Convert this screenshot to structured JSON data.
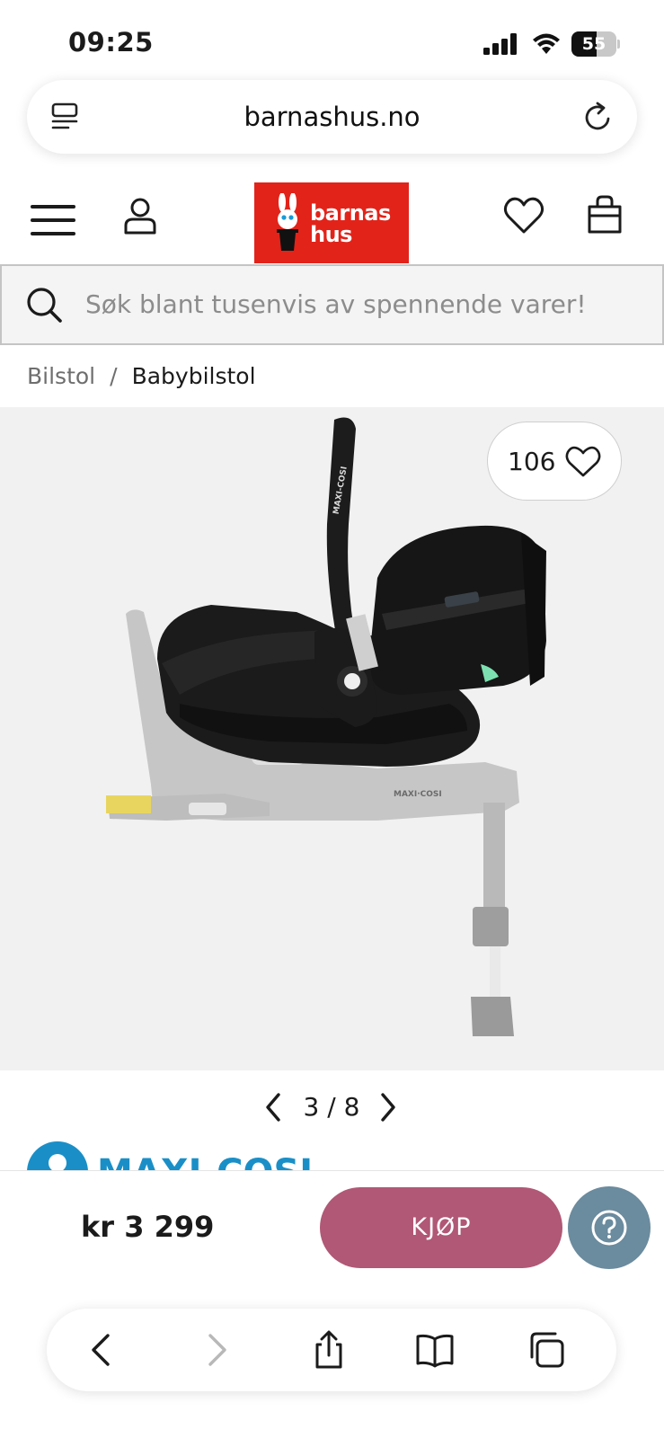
{
  "status_bar": {
    "time": "09:25",
    "battery_level": "55",
    "battery_fraction": 0.55
  },
  "browser": {
    "url": "barnashus.no"
  },
  "site": {
    "logo_line1": "barnas",
    "logo_line2": "hus",
    "brand_color": "#e2231a"
  },
  "search": {
    "placeholder": "Søk blant tusenvis av spennende varer!"
  },
  "breadcrumb": {
    "items": [
      "Bilstol",
      "Babybilstol"
    ],
    "separator": "/"
  },
  "product": {
    "favorite_count": "106",
    "gallery": {
      "current": "3",
      "separator": "/",
      "total": "8"
    },
    "seat_brand_text": "MAXI-COSI",
    "price": "kr 3 299"
  },
  "actions": {
    "buy_label": "KJØP",
    "buy_color": "#b05876",
    "help_color": "#6b8b9e"
  },
  "toolbar": {
    "icons": [
      "back-icon",
      "forward-icon",
      "share-icon",
      "bookmarks-icon",
      "tabs-icon"
    ]
  }
}
